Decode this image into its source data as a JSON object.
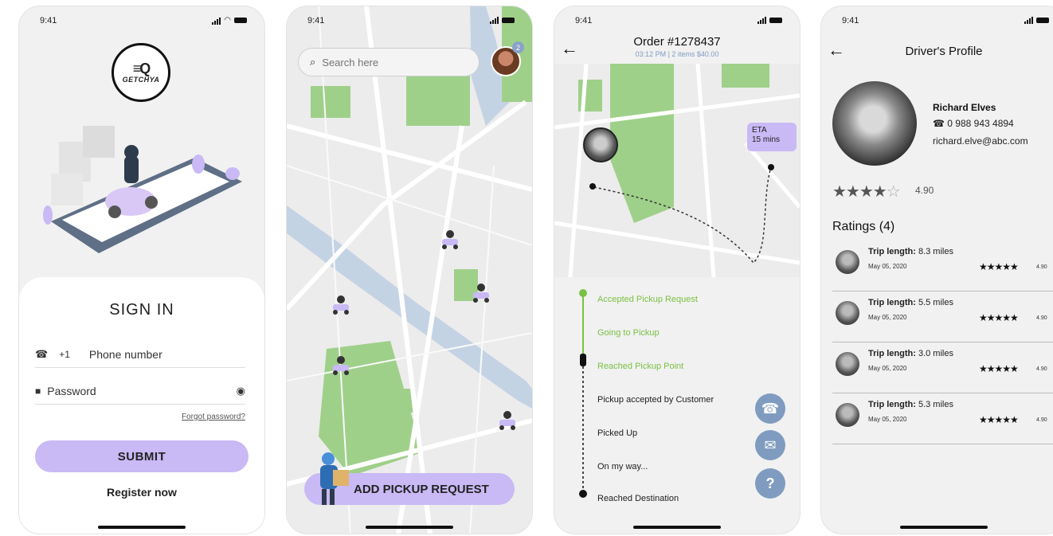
{
  "status_bar": {
    "time": "9:41"
  },
  "signin_screen": {
    "logo_text": "GETCHYA",
    "title": "SIGN IN",
    "country_code": "+1",
    "phone_placeholder": "Phone number",
    "password_placeholder": "Password",
    "forgot_label": "Forgot password?",
    "submit_label": "SUBMIT",
    "register_label": "Register now",
    "accent_color": "#c9b9f5"
  },
  "map_screen": {
    "search_placeholder": "Search here",
    "notification_count": "2",
    "add_button_label": "ADD PICKUP REQUEST"
  },
  "order_screen": {
    "title": "Order #1278437",
    "subtitle": "03:12 PM | 2 items $40.00",
    "eta_label": "ETA",
    "eta_value": "15 mins",
    "steps": [
      {
        "label": "Accepted Pickup Request",
        "status": "done"
      },
      {
        "label": "Going to Pickup",
        "status": "done"
      },
      {
        "label": "Reached Pickup Point",
        "status": "done"
      },
      {
        "label": "Pickup accepted by Customer",
        "status": "pending"
      },
      {
        "label": "Picked Up",
        "status": "pending"
      },
      {
        "label": "On my way...",
        "status": "pending"
      },
      {
        "label": "Reached Destination",
        "status": "pending"
      }
    ],
    "fab_help": "?"
  },
  "profile_screen": {
    "title": "Driver's Profile",
    "name": "Richard Elves",
    "phone": "0 988 943 4894",
    "email": "richard.elve@abc.com",
    "rating": "4.90",
    "rating_stars": 4,
    "ratings_title": "Ratings (4)",
    "ratings": [
      {
        "label": "Trip length:",
        "value": "8.3 miles",
        "date": "May 05, 2020",
        "score": "4.90"
      },
      {
        "label": "Trip length:",
        "value": "5.5 miles",
        "date": "May 05, 2020",
        "score": "4.90"
      },
      {
        "label": "Trip length:",
        "value": "3.0 miles",
        "date": "May 05, 2020",
        "score": "4.90"
      },
      {
        "label": "Trip length:",
        "value": "5.3 miles",
        "date": "May 05, 2020",
        "score": "4.90"
      }
    ]
  }
}
